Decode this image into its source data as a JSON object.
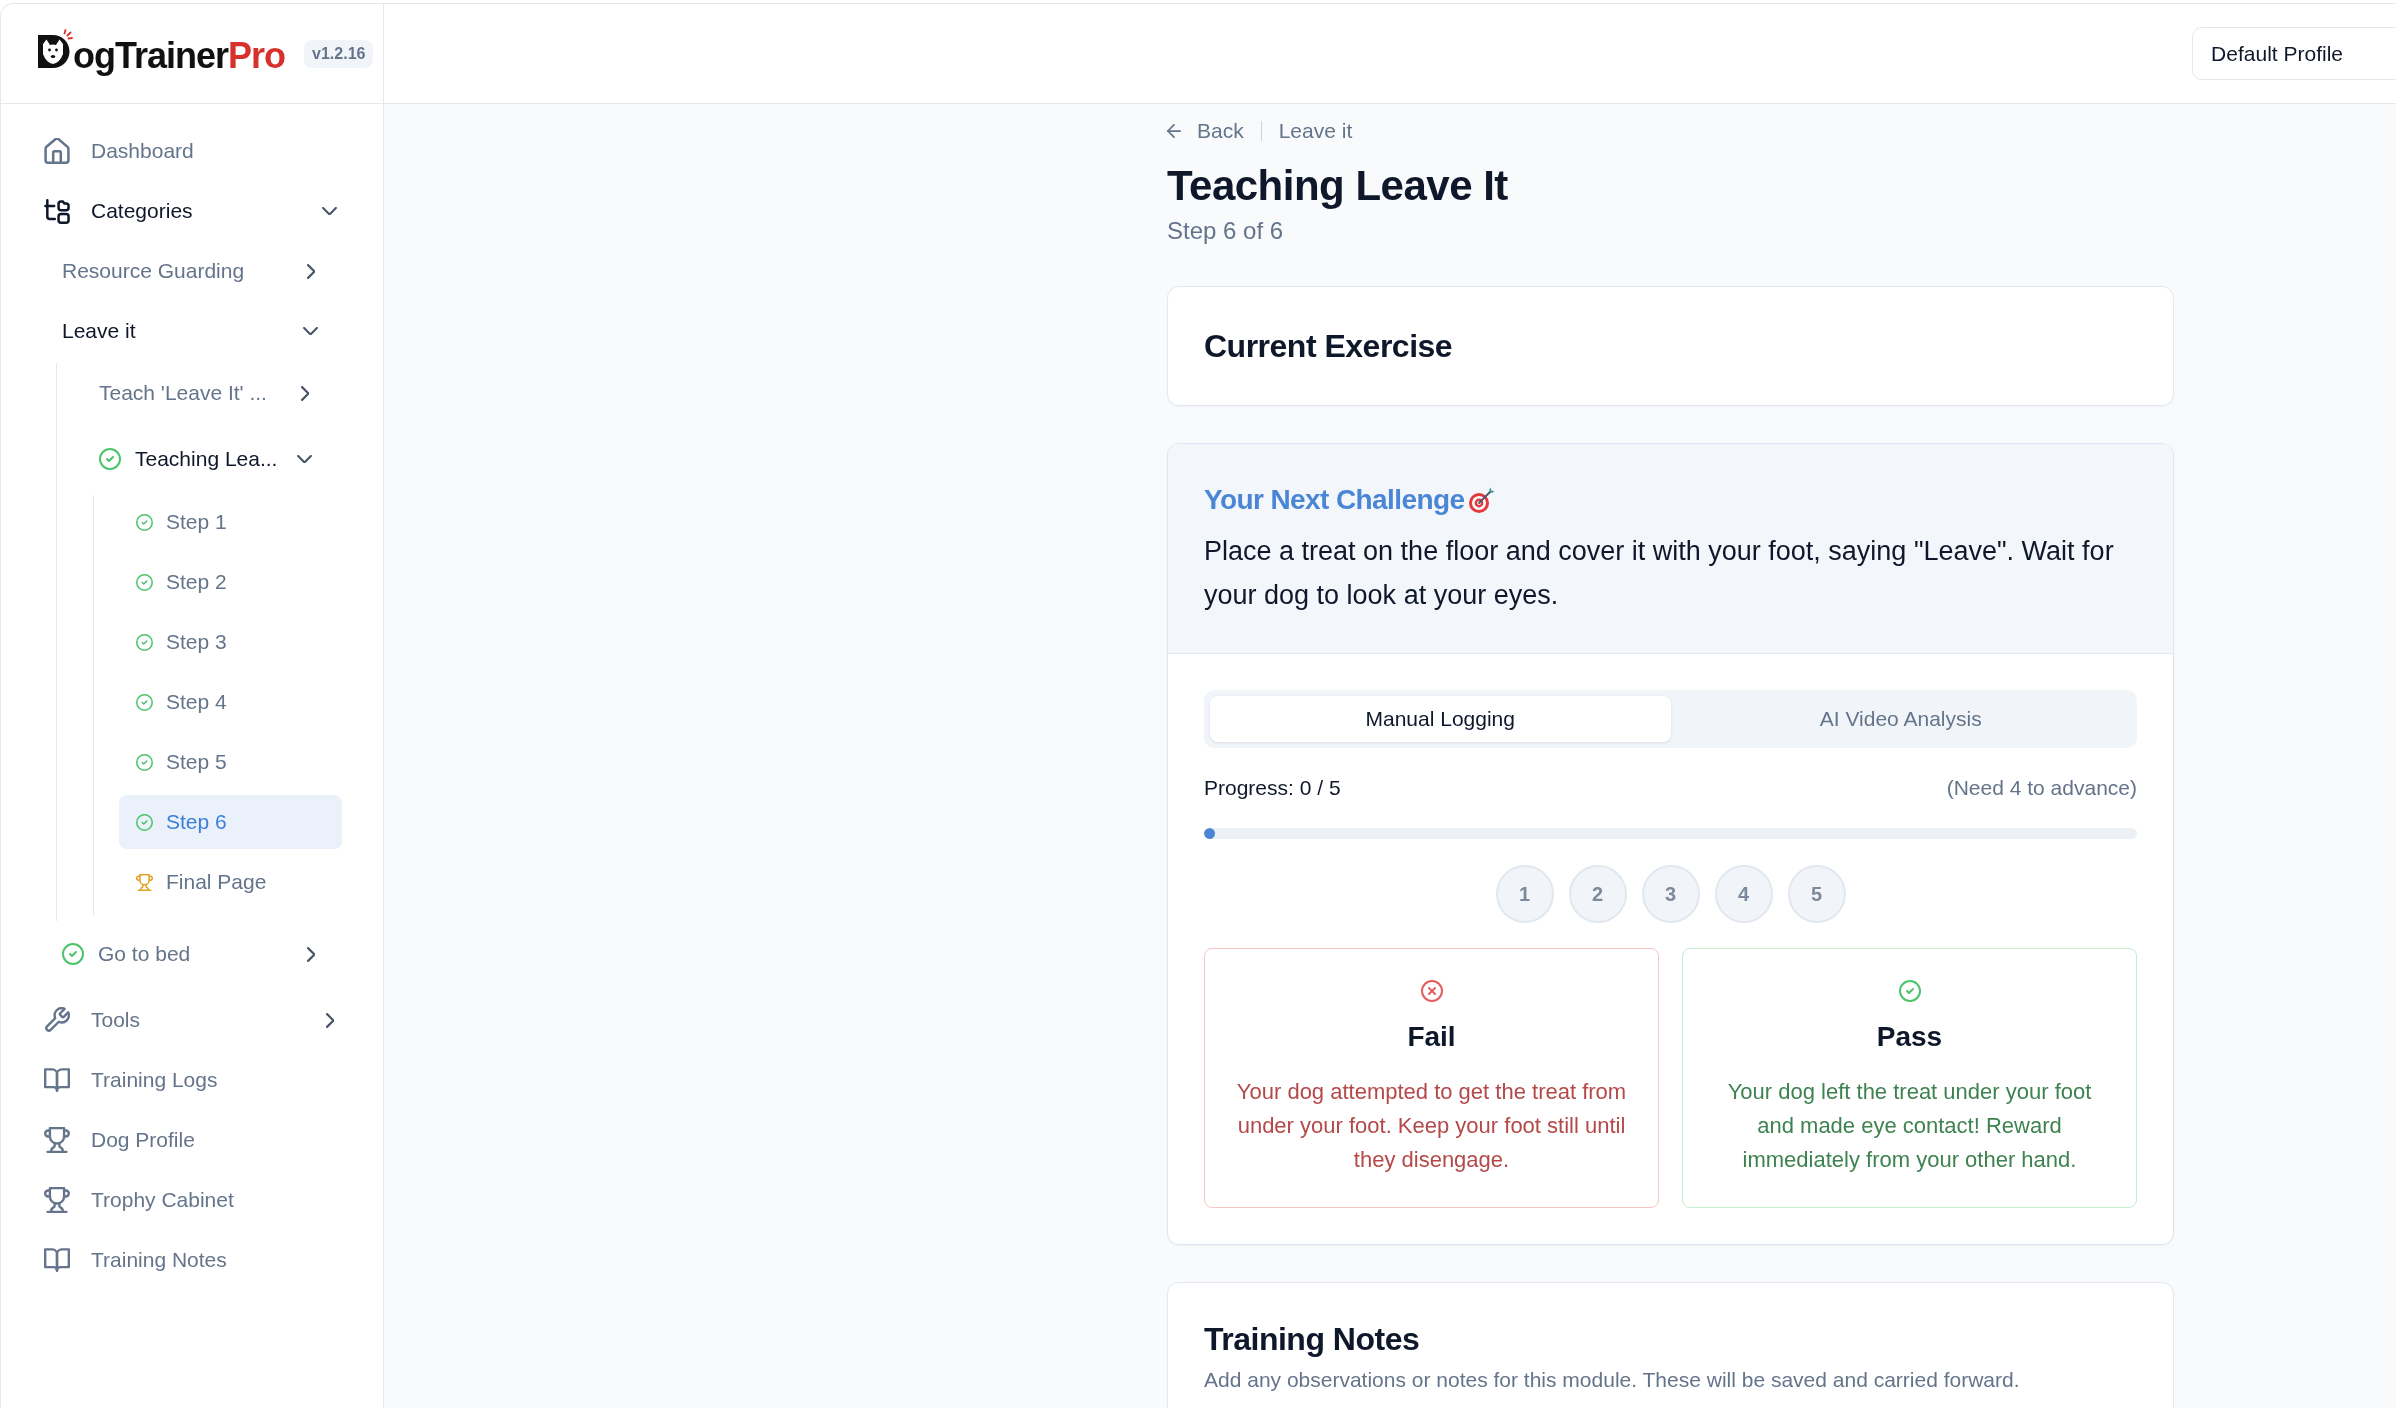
{
  "brand": {
    "name": "ogTrainer",
    "accent": "Pro",
    "version": "v1.2.16"
  },
  "profile_button": "Default Profile",
  "sidebar": {
    "items": [
      {
        "label": "Dashboard",
        "selected": false
      },
      {
        "label": "Categories",
        "expanded": true,
        "selected": false,
        "children": [
          {
            "label": "Resource Guarding",
            "expanded": false,
            "selected": false
          },
          {
            "label": "Leave it",
            "expanded": true,
            "selected": false,
            "children": [
              {
                "label": "Teach 'Leave It' ...",
                "completed": false,
                "expanded": false,
                "selected": false
              },
              {
                "label": "Teaching Lea...",
                "completed": true,
                "expanded": true,
                "selected": false,
                "children": [
                  {
                    "kind": "step",
                    "label": "Step 1",
                    "completed": true,
                    "selected": false
                  },
                  {
                    "kind": "step",
                    "label": "Step 2",
                    "completed": true,
                    "selected": false
                  },
                  {
                    "kind": "step",
                    "label": "Step 3",
                    "completed": true,
                    "selected": false
                  },
                  {
                    "kind": "step",
                    "label": "Step 4",
                    "completed": true,
                    "selected": false
                  },
                  {
                    "kind": "step",
                    "label": "Step 5",
                    "completed": true,
                    "selected": false
                  },
                  {
                    "kind": "step",
                    "label": "Step 6",
                    "completed": true,
                    "selected": true
                  },
                  {
                    "kind": "final",
                    "label": "Final Page",
                    "selected": false
                  }
                ]
              }
            ]
          },
          {
            "label": "Go to bed",
            "completed": true,
            "expanded": false,
            "selected": false
          }
        ]
      },
      {
        "label": "Tools",
        "expanded": false,
        "selected": false
      },
      {
        "label": "Training Logs",
        "selected": false
      },
      {
        "label": "Dog Profile",
        "selected": false
      },
      {
        "label": "Trophy Cabinet",
        "selected": false
      },
      {
        "label": "Training Notes",
        "selected": false
      }
    ]
  },
  "breadcrumb": {
    "back": "Back",
    "current": "Leave it"
  },
  "page": {
    "title": "Teaching Leave It",
    "subtitle": "Step 6 of 6"
  },
  "current_exercise": {
    "title": "Current Exercise"
  },
  "challenge": {
    "title": "Your Next Challenge",
    "text": "Place a treat on the floor and cover it with your foot, saying \"Leave\". Wait for your dog to look at your eyes."
  },
  "tabs": [
    {
      "label": "Manual Logging",
      "selected": true
    },
    {
      "label": "AI Video Analysis",
      "selected": false
    }
  ],
  "progress": {
    "label": "Progress: 0 / 5",
    "hint": "(Need 4 to advance)",
    "level": 0,
    "attempts": [
      "1",
      "2",
      "3",
      "4",
      "5"
    ]
  },
  "outcomes": [
    {
      "kind": "fail",
      "title": "Fail",
      "text": "Your dog attempted to get the treat from under your foot. Keep your foot still until they disengage."
    },
    {
      "kind": "pass",
      "title": "Pass",
      "text": "Your dog left the treat under your foot and made eye contact! Reward immediately from your other hand."
    }
  ],
  "notes": {
    "title": "Training Notes",
    "text": "Add any observations or notes for this module. These will be saved and carried forward."
  }
}
